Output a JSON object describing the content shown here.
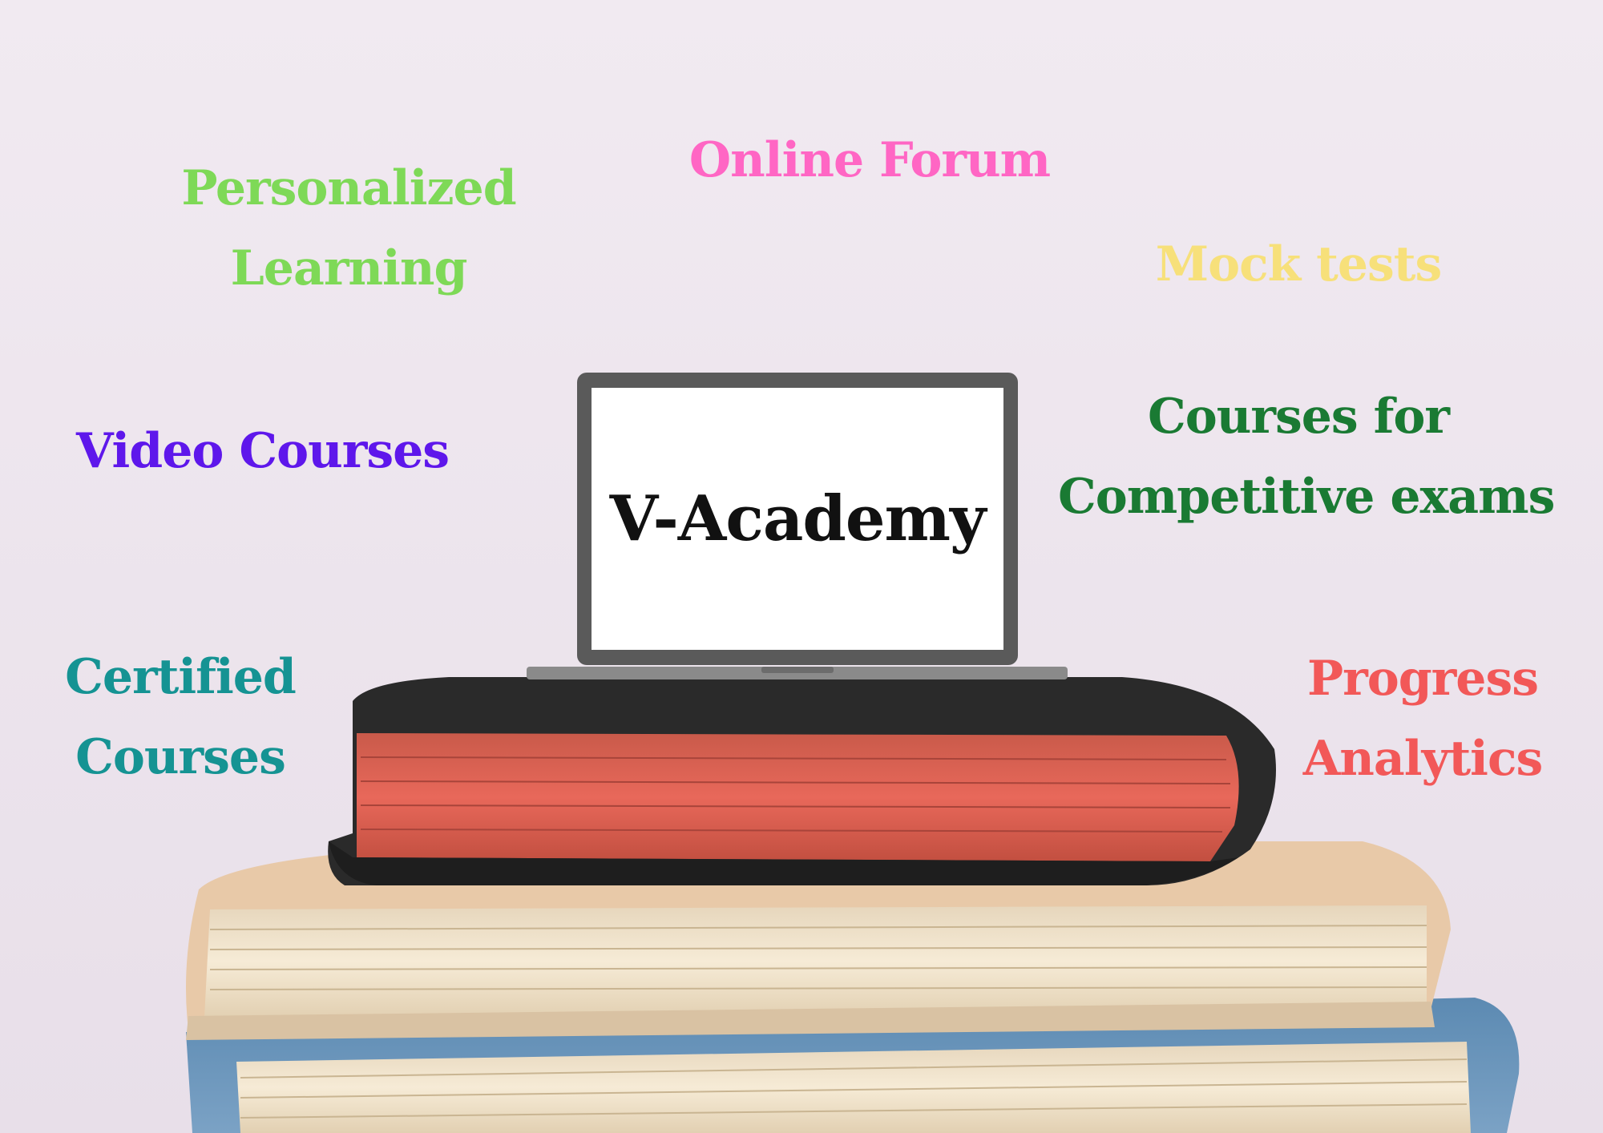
{
  "center": {
    "title": "V-Academy"
  },
  "features": {
    "personalized": {
      "line1": "Personalized",
      "line2": "Learning",
      "color": "#7ed957"
    },
    "online_forum": {
      "line1": "Online Forum",
      "color": "#ff66c4"
    },
    "mock_tests": {
      "line1": "Mock tests",
      "color": "#f7e07a"
    },
    "video_courses": {
      "line1": "Video Courses",
      "color": "#5e17eb"
    },
    "competitive": {
      "line1": "Courses for",
      "line2": "Competitive exams",
      "color": "#1a7a33"
    },
    "certified": {
      "line1": "Certified",
      "line2": "Courses",
      "color": "#159393"
    },
    "progress": {
      "line1": "Progress",
      "line2": "Analytics",
      "color": "#f25858"
    }
  },
  "colors": {
    "background": "#efe7ef",
    "laptop_frame": "#5a5a5a",
    "laptop_screen": "#ffffff",
    "book_black_cover": "#2a2a2a",
    "book_red_pages": "#e06050",
    "book_cream_pages": "#f2e6cf",
    "book_blue_cover": "#6a93b8"
  },
  "icons": [
    "laptop-icon",
    "book-stack"
  ]
}
